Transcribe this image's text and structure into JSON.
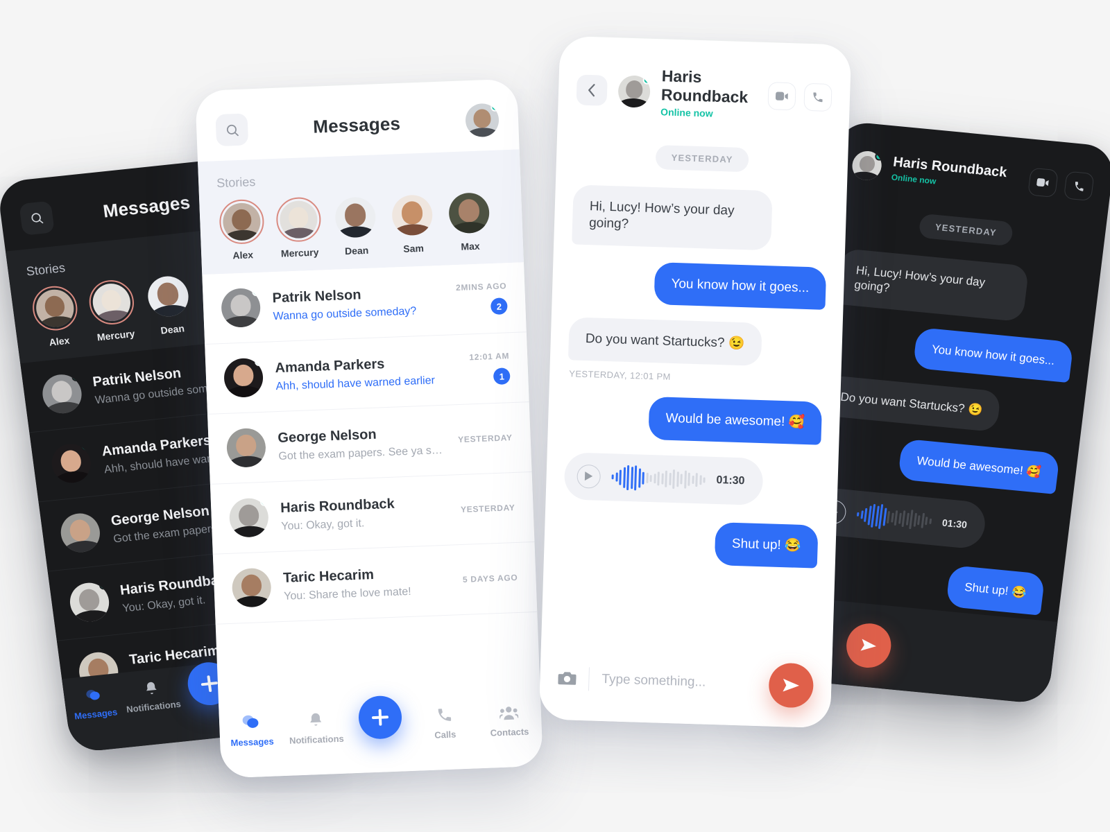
{
  "app": {
    "accent_blue": "#2f6ef7",
    "accent_orange": "#e0604a",
    "online_green": "#15c3a6",
    "story_ring": "#d98a80",
    "page_background": "#f5f5f5"
  },
  "messages_screen": {
    "title": "Messages",
    "search_icon": "search-icon",
    "profile_avatar": "me",
    "stories": {
      "label": "Stories",
      "items": [
        {
          "name": "Alex",
          "has_new": true,
          "avatar": "alex"
        },
        {
          "name": "Mercury",
          "has_new": true,
          "avatar": "mercury"
        },
        {
          "name": "Dean",
          "has_new": false,
          "avatar": "dean"
        },
        {
          "name": "Sam",
          "has_new": false,
          "avatar": "sam"
        },
        {
          "name": "Max",
          "has_new": false,
          "avatar": "max"
        }
      ]
    },
    "conversations": [
      {
        "name": "Patrik Nelson",
        "preview": "Wanna go outside someday?",
        "time": "2MINS AGO",
        "unread": 2,
        "online": true,
        "avatar": "patrik"
      },
      {
        "name": "Amanda Parkers",
        "preview": "Ahh, should have warned earlier",
        "time": "12:01 AM",
        "unread": 1,
        "online": true,
        "avatar": "amanda"
      },
      {
        "name": "George Nelson",
        "preview": "Got the exam papers. See ya soon!",
        "time": "YESTERDAY",
        "unread": 0,
        "online": false,
        "avatar": "george"
      },
      {
        "name": "Haris Roundback",
        "preview": "You: Okay, got it.",
        "time": "YESTERDAY",
        "unread": 0,
        "online": true,
        "avatar": "haris"
      },
      {
        "name": "Taric Hecarim",
        "preview": "You: Share the love mate!",
        "time": "5 DAYS AGO",
        "unread": 0,
        "online": false,
        "avatar": "taric"
      }
    ],
    "tabbar": {
      "items": [
        {
          "label": "Messages",
          "icon": "chat-bubbles-icon",
          "active": true
        },
        {
          "label": "Notifications",
          "icon": "bell-icon",
          "active": false
        },
        {
          "label": "Calls",
          "icon": "phone-icon",
          "active": false
        },
        {
          "label": "Contacts",
          "icon": "contacts-icon",
          "active": false
        }
      ],
      "fab": {
        "icon": "plus-icon",
        "label": "New message"
      }
    }
  },
  "chat_screen": {
    "back_icon": "chevron-left-icon",
    "contact_name": "Haris Roundback",
    "status": "Online now",
    "contact_avatar": "haris",
    "actions": [
      {
        "icon": "video-camera-icon",
        "label": "Video call"
      },
      {
        "icon": "phone-icon",
        "label": "Voice call"
      }
    ],
    "day_divider": "YESTERDAY",
    "messages": [
      {
        "type": "text",
        "from": "them",
        "text": "Hi, Lucy! How’s your day going?"
      },
      {
        "type": "text",
        "from": "me",
        "text": "You know how it goes..."
      },
      {
        "type": "text",
        "from": "them",
        "text": "Do you want Startucks? 😉",
        "timestamp": "YESTERDAY, 12:01 PM"
      },
      {
        "type": "text",
        "from": "me",
        "text": "Would be awesome! 🥰"
      },
      {
        "type": "voice",
        "from": "them",
        "duration": "01:30",
        "play_icon": "play-icon"
      },
      {
        "type": "text",
        "from": "me",
        "text": "Shut up! 😂"
      }
    ],
    "composer": {
      "camera_icon": "camera-icon",
      "placeholder": "Type something...",
      "send_icon": "send-icon"
    }
  }
}
